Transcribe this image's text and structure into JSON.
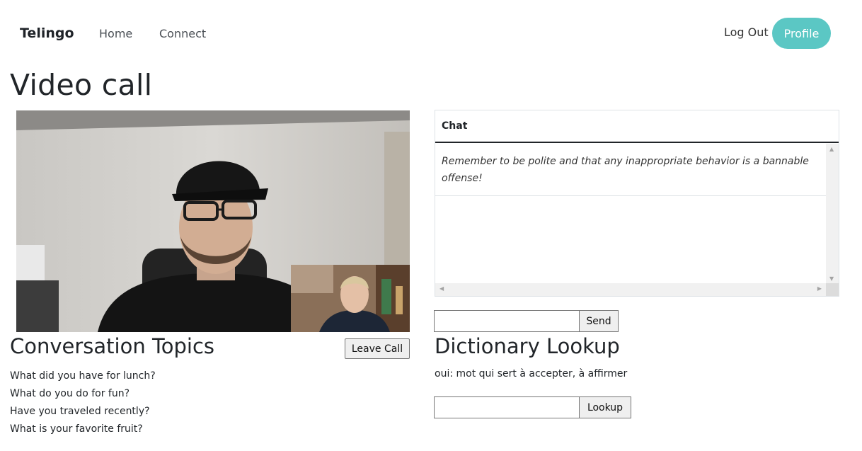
{
  "nav": {
    "brand": "Telingo",
    "home": "Home",
    "connect": "Connect",
    "logout": "Log Out",
    "profile": "Profile",
    "accent_color": "#5bc7c4"
  },
  "page": {
    "title": "Video call"
  },
  "video": {
    "remote_feed": "remote-participant-video",
    "local_feed": "local-self-view-video"
  },
  "topics": {
    "title": "Conversation Topics",
    "leave_label": "Leave Call",
    "items": [
      "What did you have for lunch?",
      "What do you do for fun?",
      "Have you traveled recently?",
      "What is your favorite fruit?"
    ]
  },
  "chat": {
    "header": "Chat",
    "messages": [
      "Remember to be polite and that any inappropriate behavior is a bannable offense!"
    ],
    "input_value": "",
    "send_label": "Send"
  },
  "dictionary": {
    "title": "Dictionary Lookup",
    "result": "oui: mot qui sert à accepter, à affirmer",
    "input_value": "",
    "lookup_label": "Lookup"
  }
}
